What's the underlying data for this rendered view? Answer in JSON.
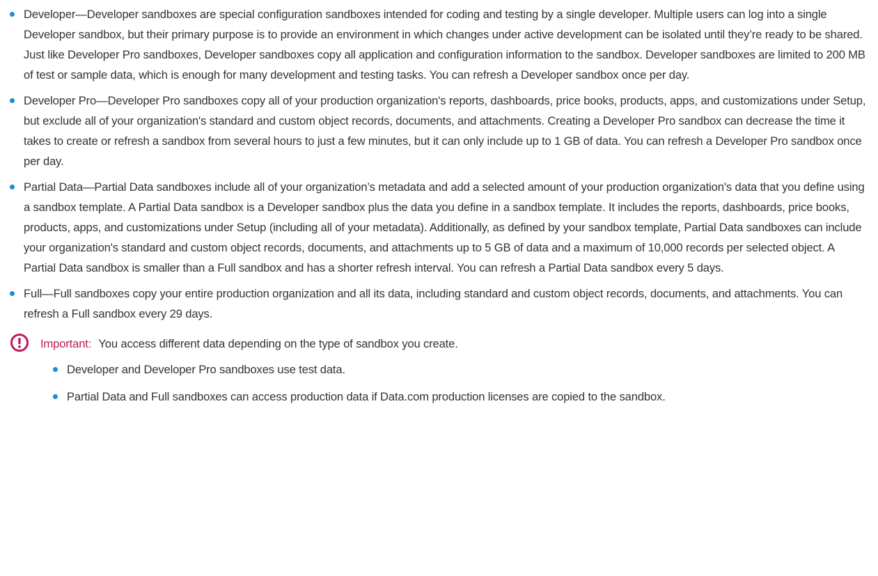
{
  "sandbox_types": [
    {
      "text": "Developer—Developer sandboxes are special configuration sandboxes intended for coding and testing by a single developer. Multiple users can log into a single Developer sandbox, but their primary purpose is to provide an environment in which changes under active development can be isolated until they’re ready to be shared. Just like Developer Pro sandboxes, Developer sandboxes copy all application and configuration information to the sandbox. Developer sandboxes are limited to 200 MB of test or sample data, which is enough for many development and testing tasks. You can refresh a Developer sandbox once per day."
    },
    {
      "text": "Developer Pro—Developer Pro sandboxes copy all of your production organization's reports, dashboards, price books, products, apps, and customizations under Setup, but exclude all of your organization's standard and custom object records, documents, and attachments. Creating a Developer Pro sandbox can decrease the time it takes to create or refresh a sandbox from several hours to just a few minutes, but it can only include up to 1 GB of data. You can refresh a Developer Pro sandbox once per day."
    },
    {
      "text": "Partial Data—Partial Data sandboxes include all of your organization’s metadata and add a selected amount of your production organization's data that you define using a sandbox template. A Partial Data sandbox is a Developer sandbox plus the data you define in a sandbox template. It includes the reports, dashboards, price books, products, apps, and customizations under Setup (including all of your metadata). Additionally, as defined by your sandbox template, Partial Data sandboxes can include your organization's standard and custom object records, documents, and attachments up to 5 GB of data and a maximum of 10,000 records per selected object. A Partial Data sandbox is smaller than a Full sandbox and has a shorter refresh interval. You can refresh a Partial Data sandbox every 5 days."
    },
    {
      "text": "Full—Full sandboxes copy your entire production organization and all its data, including standard and custom object records, documents, and attachments. You can refresh a Full sandbox every 29 days."
    }
  ],
  "important": {
    "icon": "exclamation-circle-icon",
    "label": "Important:",
    "text": "You access different data depending on the type of sandbox you create.",
    "items": [
      "Developer and Developer Pro sandboxes use test data.",
      "Partial Data and Full sandboxes can access production data if Data.com production licenses are copied to the sandbox."
    ]
  },
  "colors": {
    "bullet": "#1a8fd0",
    "important": "#c2185b",
    "text": "#333333"
  }
}
